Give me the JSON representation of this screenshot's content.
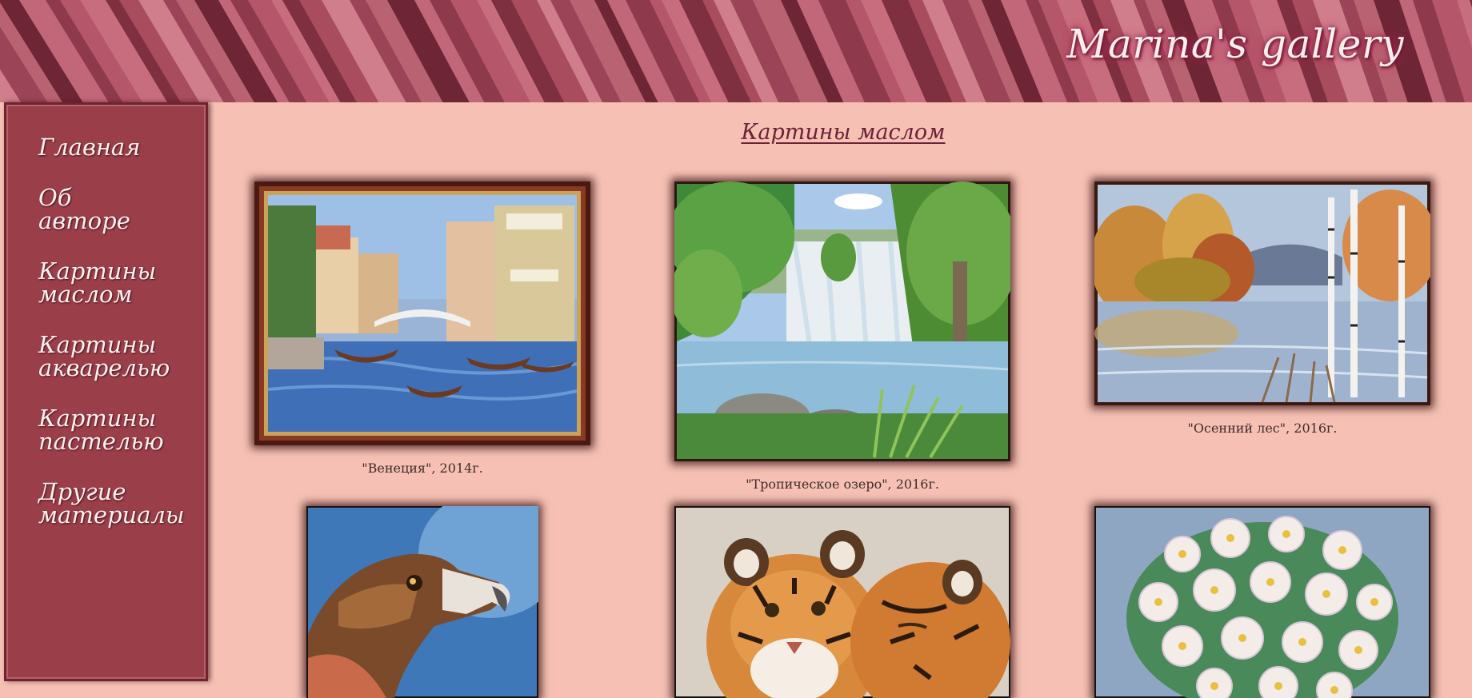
{
  "header": {
    "title": "Marina's gallery"
  },
  "sidebar": {
    "items": [
      {
        "label": "Главная"
      },
      {
        "label": "Об\nавторе"
      },
      {
        "label": "Картины\nмаслом"
      },
      {
        "label": "Картины\nакварелью"
      },
      {
        "label": "Картины\nпастелью"
      },
      {
        "label": "Другие\nматериалы"
      }
    ]
  },
  "main": {
    "section_title": "Картины маслом",
    "paintings": [
      {
        "caption": "\"Венеция\", 2014г.",
        "subject": "venice-canal"
      },
      {
        "caption": "\"Тропическое озеро\", 2016г.",
        "subject": "tropical-waterfall"
      },
      {
        "caption": "\"Осенний лес\", 2016г.",
        "subject": "autumn-forest-lake"
      },
      {
        "caption": "",
        "subject": "eagle"
      },
      {
        "caption": "",
        "subject": "tigers"
      },
      {
        "caption": "",
        "subject": "white-flowers"
      }
    ]
  },
  "colors": {
    "header": "#a34a5b",
    "sidebar": "#9a3f4a",
    "content_background": "#f6c1b4",
    "section_title": "#6b2136"
  }
}
